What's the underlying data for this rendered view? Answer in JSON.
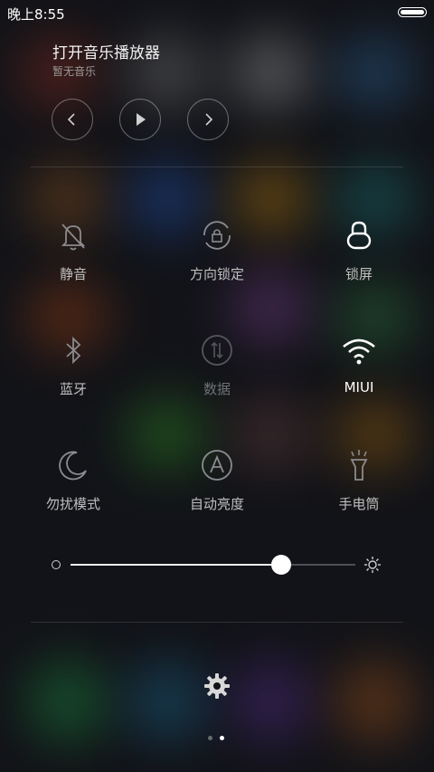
{
  "status": {
    "time": "晚上8:55",
    "battery_level": 1.0
  },
  "music": {
    "title": "打开音乐播放器",
    "subtitle": "暂无音乐",
    "prev_icon": "chevron-left-icon",
    "play_icon": "play-icon",
    "next_icon": "chevron-right-icon"
  },
  "toggles": {
    "mute": {
      "label": "静音",
      "icon": "bell-off-icon",
      "state": "off"
    },
    "orientation_lock": {
      "label": "方向锁定",
      "icon": "rotation-lock-icon",
      "state": "off"
    },
    "lock_screen": {
      "label": "锁屏",
      "icon": "lock-icon",
      "state": "on"
    },
    "bluetooth": {
      "label": "蓝牙",
      "icon": "bluetooth-icon",
      "state": "off"
    },
    "data": {
      "label": "数据",
      "icon": "mobile-data-icon",
      "state": "disabled"
    },
    "wifi": {
      "label": "MIUI",
      "icon": "wifi-icon",
      "state": "on"
    },
    "dnd": {
      "label": "勿扰模式",
      "icon": "moon-icon",
      "state": "off"
    },
    "auto_brightness": {
      "label": "自动亮度",
      "icon": "auto-brightness-icon",
      "state": "off"
    },
    "flashlight": {
      "label": "手电筒",
      "icon": "flashlight-icon",
      "state": "off"
    }
  },
  "brightness": {
    "value": 0.74,
    "low_icon": "brightness-low-icon",
    "high_icon": "brightness-high-icon"
  },
  "footer": {
    "settings_icon": "gear-icon",
    "page_count": 2,
    "current_page": 2
  },
  "colors": {
    "on": "#ffffff",
    "off": "#bfbfbf",
    "disabled": "#6f7075",
    "background": "#121318"
  }
}
